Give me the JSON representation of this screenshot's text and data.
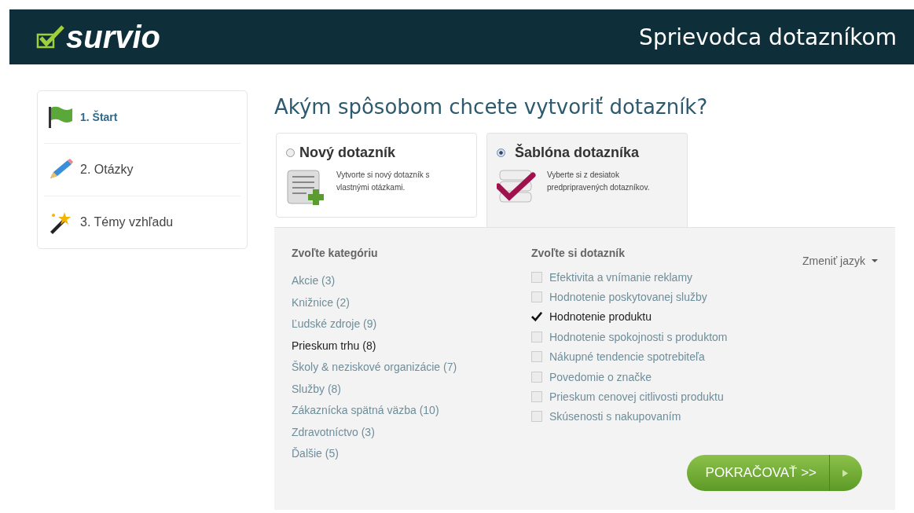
{
  "header": {
    "logo": "survio",
    "title": "Sprievodca dotazníkom"
  },
  "steps": [
    {
      "label": "1. Štart",
      "selected": true
    },
    {
      "label": "2. Otázky",
      "selected": false
    },
    {
      "label": "3. Témy vzhľadu",
      "selected": false
    }
  ],
  "heading": "Akým spôsobom chcete vytvoriť dotazník?",
  "options": [
    {
      "title": "Nový dotazník",
      "description": "Vytvorte si nový dotazník s vlastnými otázkami.",
      "selected": false
    },
    {
      "title": "Šablóna dotazníka",
      "description": "Vyberte si z desiatok predpripravených dotazníkov.",
      "selected": true
    }
  ],
  "categories": {
    "heading": "Zvoľte kategóriu",
    "items": [
      {
        "label": "Akcie (3)",
        "selected": false
      },
      {
        "label": "Knižnice (2)",
        "selected": false
      },
      {
        "label": "Ľudské zdroje (9)",
        "selected": false
      },
      {
        "label": "Prieskum trhu (8)",
        "selected": true
      },
      {
        "label": "Školy & neziskové organizácie (7)",
        "selected": false
      },
      {
        "label": "Služby (8)",
        "selected": false
      },
      {
        "label": "Zákaznícka spätná väzba (10)",
        "selected": false
      },
      {
        "label": "Zdravotníctvo (3)",
        "selected": false
      },
      {
        "label": "Ďalšie (5)",
        "selected": false
      }
    ]
  },
  "surveys": {
    "heading": "Zvoľte si dotazník",
    "language": "Zmeniť jazyk",
    "items": [
      {
        "label": "Efektivita a vnímanie reklamy",
        "checked": false
      },
      {
        "label": "Hodnotenie poskytovanej služby",
        "checked": false
      },
      {
        "label": "Hodnotenie produktu",
        "checked": true
      },
      {
        "label": "Hodnotenie spokojnosti s produktom",
        "checked": false
      },
      {
        "label": "Nákupné tendencie spotrebiteľa",
        "checked": false
      },
      {
        "label": "Povedomie o značke",
        "checked": false
      },
      {
        "label": "Prieskum cenovej citlivosti produktu",
        "checked": false
      },
      {
        "label": "Skúsenosti s nakupovaním",
        "checked": false
      }
    ]
  },
  "continue_button": "POKRAČOVAŤ >>"
}
